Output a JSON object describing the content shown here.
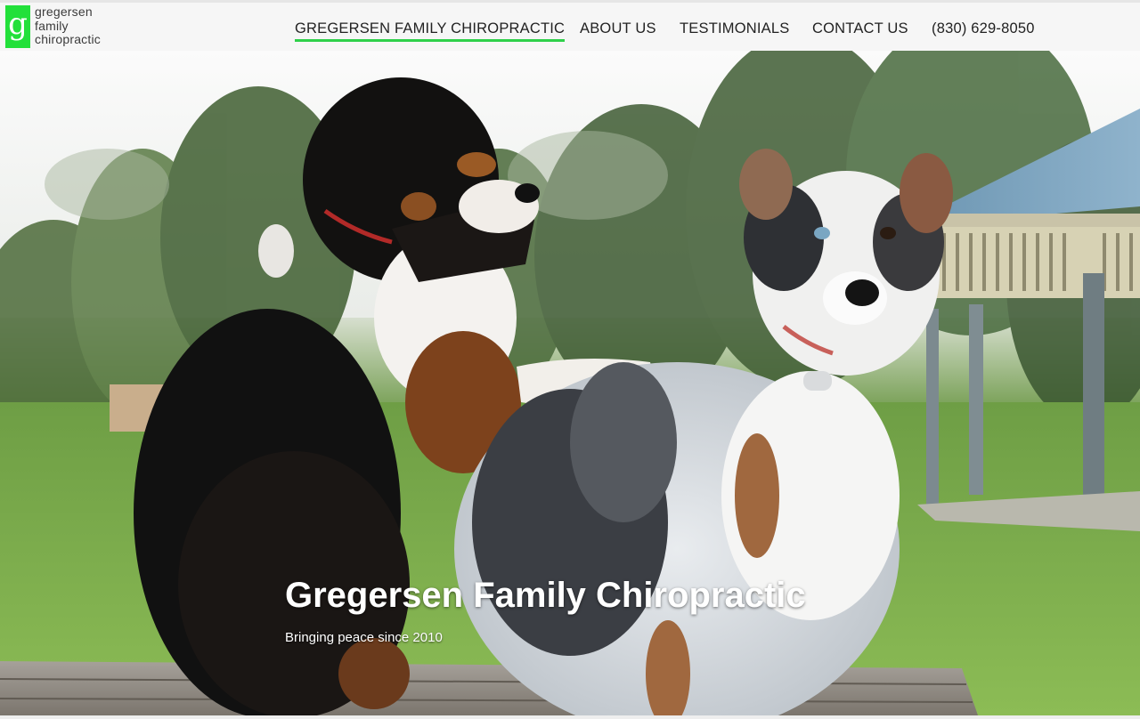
{
  "brand": {
    "logo_letter": "g",
    "logo_lines": [
      "gregersen",
      "family",
      "chiropractic"
    ],
    "accent_color": "#22e03a"
  },
  "nav": {
    "items": [
      {
        "label": "GREGERSEN FAMILY CHIROPRACTIC",
        "active": true
      },
      {
        "label": "ABOUT US",
        "active": false
      },
      {
        "label": "TESTIMONIALS",
        "active": false
      },
      {
        "label": "CONTACT US",
        "active": false
      }
    ],
    "phone": "(830) 629-8050"
  },
  "hero": {
    "image_subject": "two-dogs-on-picnic-table-photo",
    "title": "Gregersen Family Chiropractic",
    "subtitle": "Bringing peace since 2010"
  }
}
